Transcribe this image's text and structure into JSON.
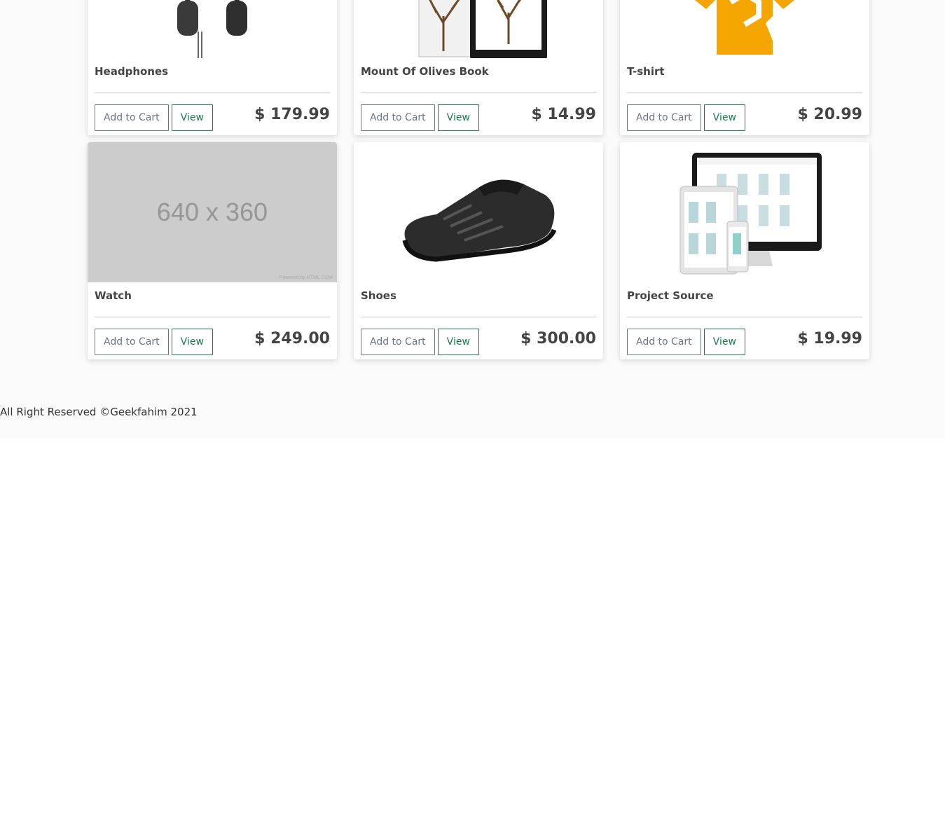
{
  "products": [
    {
      "name": "Headphones",
      "price": "$ 179.99",
      "add_label": "Add to Cart",
      "view_label": "View",
      "image": "headphones-image"
    },
    {
      "name": "Mount Of Olives Book",
      "price": "$ 14.99",
      "add_label": "Add to Cart",
      "view_label": "View",
      "image": "book-image"
    },
    {
      "name": "T-shirt",
      "price": "$ 20.99",
      "add_label": "Add to Cart",
      "view_label": "View",
      "image": "tshirt-image"
    },
    {
      "name": "Watch",
      "price": "$ 249.00",
      "add_label": "Add to Cart",
      "view_label": "View",
      "image": "placeholder-image",
      "placeholder_text": "640 x 360",
      "placeholder_credit": "Powered by HTML.COM"
    },
    {
      "name": "Shoes",
      "price": "$ 300.00",
      "add_label": "Add to Cart",
      "view_label": "View",
      "image": "shoe-image"
    },
    {
      "name": "Project Source",
      "price": "$ 19.99",
      "add_label": "Add to Cart",
      "view_label": "View",
      "image": "devices-image"
    }
  ],
  "colors": {
    "view_button": "#1b7a4f",
    "cart_button": "#6c757d",
    "page_bg": "#fafafa"
  },
  "footer": {
    "text": "All Right Reserved ©Geekfahim 2021"
  }
}
